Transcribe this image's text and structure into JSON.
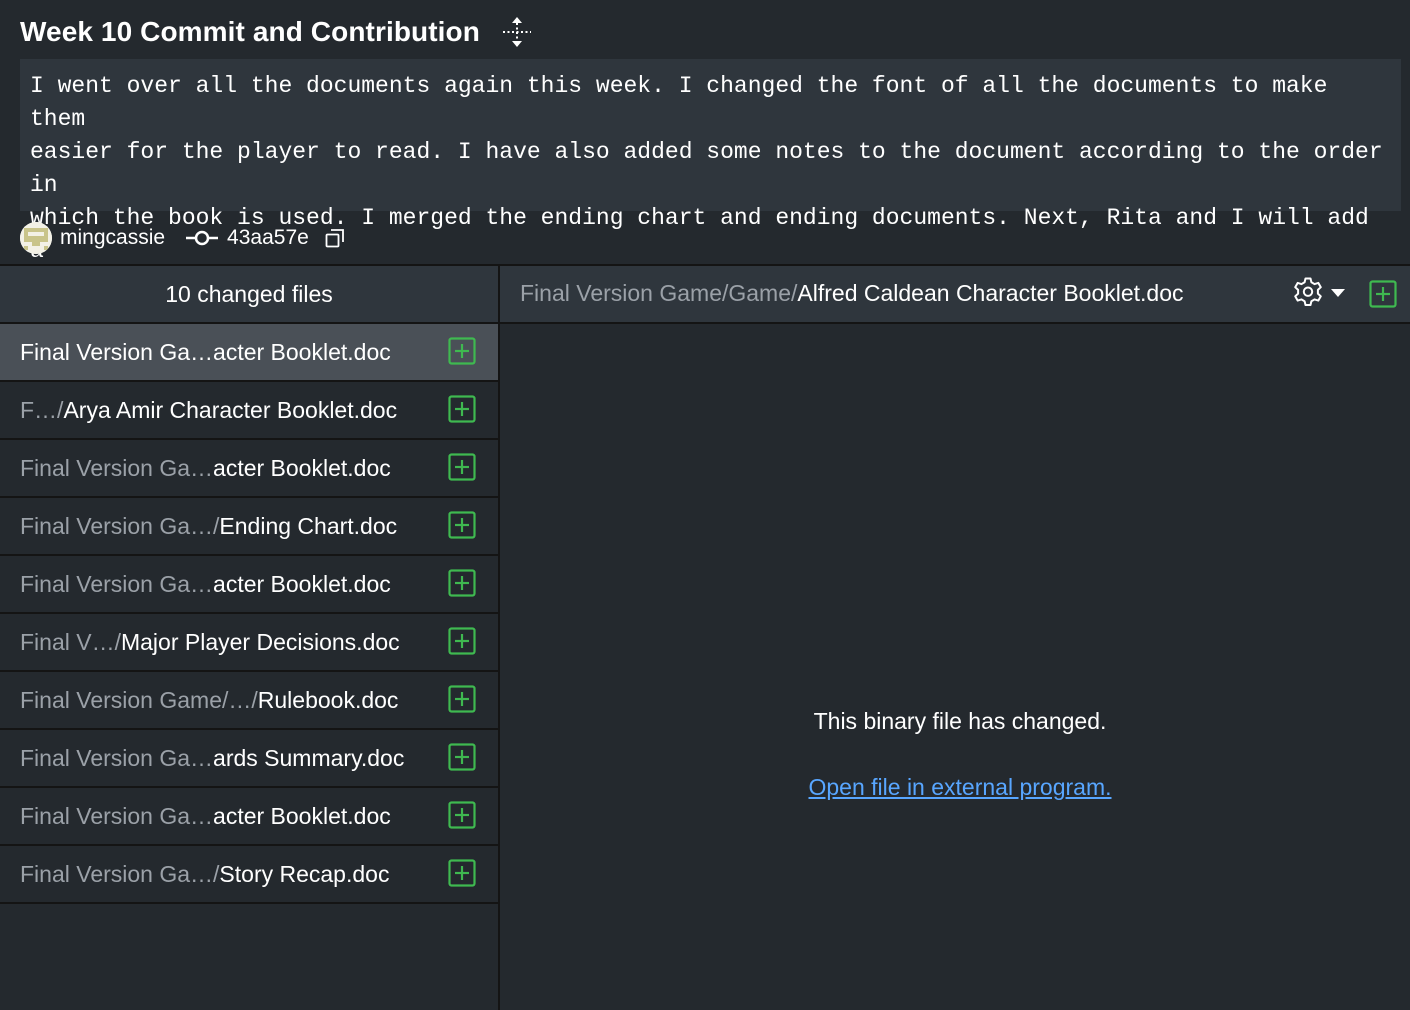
{
  "commit": {
    "title": "Week 10 Commit and Contribution",
    "description": "I went over all the documents again this week. I changed the font of all the documents to make them\neasier for the player to read. I have also added some notes to the document according to the order in\nwhich the book is used. I merged the ending chart and ending documents. Next, Rita and I will add a\ncover to the character book.",
    "author": "mingcassie",
    "sha": "43aa57e"
  },
  "sidebar": {
    "header": "10 changed files",
    "files": [
      {
        "dir": "Final Version Ga…",
        "name": "acter Booklet.doc",
        "selected": true
      },
      {
        "dir": "F…/",
        "name": "Arya Amir Character Booklet.doc",
        "selected": false
      },
      {
        "dir": "Final Version Ga…",
        "name": "acter Booklet.doc",
        "selected": false
      },
      {
        "dir": "Final Version Ga…/",
        "name": "Ending Chart.doc",
        "selected": false
      },
      {
        "dir": "Final Version Ga…",
        "name": "acter Booklet.doc",
        "selected": false
      },
      {
        "dir": "Final V…/",
        "name": "Major Player Decisions.doc",
        "selected": false
      },
      {
        "dir": "Final Version Game/…/",
        "name": "Rulebook.doc",
        "selected": false
      },
      {
        "dir": "Final Version Ga…",
        "name": "ards Summary.doc",
        "selected": false
      },
      {
        "dir": "Final Version Ga…",
        "name": "acter Booklet.doc",
        "selected": false
      },
      {
        "dir": "Final Version Ga…/",
        "name": "Story Recap.doc",
        "selected": false
      }
    ]
  },
  "diff": {
    "path_dir": "Final Version Game/Game/",
    "path_name": "Alfred Caldean Character Booklet.doc",
    "binary_message": "This binary file has changed.",
    "open_link": "Open file in external program."
  },
  "colors": {
    "background": "#24292e",
    "panel": "#2f363d",
    "selected_row": "#4a5057",
    "added_green": "#3fb950",
    "link_blue": "#58a6ff",
    "muted_text": "#9ba1a8"
  },
  "icons": {
    "expand": "expand-arrows-icon",
    "commit": "git-commit-icon",
    "copy": "copy-icon",
    "added": "file-added-icon",
    "settings": "gear-icon",
    "dropdown": "caret-down-icon"
  }
}
